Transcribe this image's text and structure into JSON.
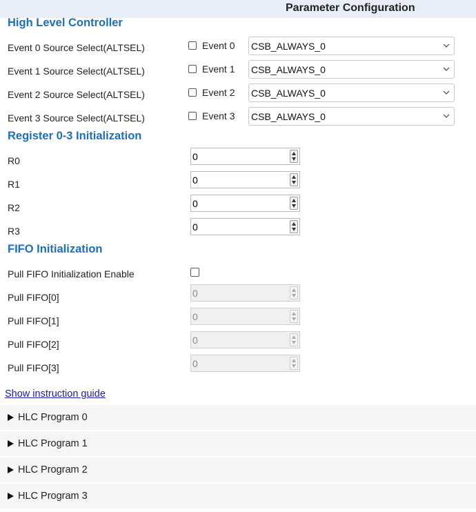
{
  "header": {
    "title": "Parameter Configuration"
  },
  "hlc": {
    "title": "High Level Controller",
    "rows": [
      {
        "label": "Event 0 Source Select(ALTSEL)",
        "event_label": "Event 0",
        "checked": false,
        "value": "CSB_ALWAYS_0"
      },
      {
        "label": "Event 1 Source Select(ALTSEL)",
        "event_label": "Event 1",
        "checked": false,
        "value": "CSB_ALWAYS_0"
      },
      {
        "label": "Event 2 Source Select(ALTSEL)",
        "event_label": "Event 2",
        "checked": false,
        "value": "CSB_ALWAYS_0"
      },
      {
        "label": "Event 3 Source Select(ALTSEL)",
        "event_label": "Event 3",
        "checked": false,
        "value": "CSB_ALWAYS_0"
      }
    ]
  },
  "registers": {
    "title": "Register 0-3 Initialization",
    "rows": [
      {
        "label": "R0",
        "value": "0"
      },
      {
        "label": "R1",
        "value": "0"
      },
      {
        "label": "R2",
        "value": "0"
      },
      {
        "label": "R3",
        "value": "0"
      }
    ]
  },
  "fifo": {
    "title": "FIFO Initialization",
    "enable_label": "Pull FIFO Initialization Enable",
    "enable_checked": false,
    "rows": [
      {
        "label": "Pull FIFO[0]",
        "value": "0",
        "disabled": true
      },
      {
        "label": "Pull FIFO[1]",
        "value": "0",
        "disabled": true
      },
      {
        "label": "Pull FIFO[2]",
        "value": "0",
        "disabled": true
      },
      {
        "label": "Pull FIFO[3]",
        "value": "0",
        "disabled": true
      }
    ]
  },
  "guide_link": "Show instruction guide",
  "programs": [
    {
      "label": "HLC Program 0",
      "expanded": false
    },
    {
      "label": "HLC Program 1",
      "expanded": false
    },
    {
      "label": "HLC Program 2",
      "expanded": false
    },
    {
      "label": "HLC Program 3",
      "expanded": false
    }
  ],
  "colors": {
    "header_bg": "#e8eef8",
    "section_title": "#1a6fc4",
    "link": "#1a1ab0",
    "accordion_bg": "#f6f6f6"
  }
}
